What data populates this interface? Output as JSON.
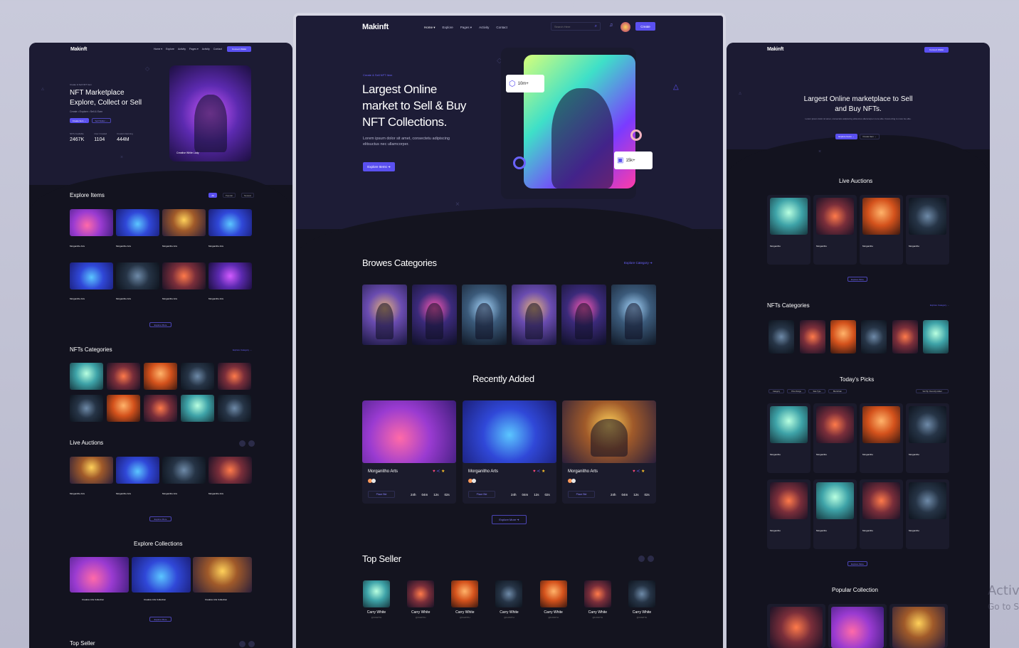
{
  "center": {
    "logo": "Makinft",
    "nav": [
      "Home ▾",
      "Explore",
      "Pages ▾",
      "Activity",
      "Contact"
    ],
    "search_placeholder": "Search Here",
    "create_label": "Create",
    "hero": {
      "eyebrow": "Create & Sell NFT Item",
      "title_lines": [
        "Largest Online",
        "market to Sell & Buy",
        "NFT Collections."
      ],
      "desc_lines": [
        "Lorem ipsum dolor sit amet, consectetu adipiscing",
        "elitsuctus nec ullamcorper."
      ],
      "cta": "Explore Items ➔",
      "badge1_value": "10m+",
      "badge2_value": "15k+"
    },
    "categories": {
      "title": "Browes Categories",
      "link": "Explore Category ➔"
    },
    "recent": {
      "title": "Recently Added",
      "cards": [
        {
          "name": "Morganitho Arts",
          "bid": "Place Bid",
          "timer": [
            "24h",
            "04m",
            "12s",
            "02s"
          ]
        },
        {
          "name": "Morganitho Arts",
          "bid": "Place Bid",
          "timer": [
            "24h",
            "04m",
            "12s",
            "02s"
          ]
        },
        {
          "name": "Morganitho Arts",
          "bid": "Place Bid",
          "timer": [
            "24h",
            "04m",
            "12s",
            "02s"
          ]
        }
      ],
      "more": "Explore More ➔"
    },
    "top_seller": {
      "title": "Top Seller",
      "sellers": [
        "Carry White",
        "Carry White",
        "Carry White",
        "Carry White",
        "Carry White",
        "Carry White",
        "Carry White"
      ],
      "handle": "@KAWITH"
    }
  },
  "left": {
    "logo": "Makinft",
    "nav": [
      "Home ▾",
      "Explore",
      "Activity",
      "Pages ▾",
      "Activity",
      "Contact"
    ],
    "connect": "Connect Wallet",
    "hero": {
      "eyebrow": "Create & Sell NFT Item",
      "title_lines": [
        "NFT Marketplace",
        "Explore, Collect or Sell"
      ],
      "sub": "Create • Explore • Sell & Earn",
      "btn1": "Create Item →",
      "btn2": "Sell Wallet →",
      "stats": [
        {
          "label": "NFTs Available",
          "value": "2467K"
        },
        {
          "label": "User Created",
          "value": "1104"
        },
        {
          "label": "Creators Earning",
          "value": "444M"
        }
      ],
      "card_title": "Creative White Lady"
    },
    "explore_title": "Explore Items",
    "filters": [
      "All",
      "Popular",
      "Newest"
    ],
    "item_name": "Morganitho Arts",
    "more": "Explore More",
    "nft_categories": "NFTs Categories",
    "categories_link": "Explore Category →",
    "live_auctions": "Live Auctions",
    "collections_title": "Explore Collections",
    "collection_name": "Creative Arts Collection",
    "top_seller": "Top Seller"
  },
  "right": {
    "logo": "Makinft",
    "connect": "Connect Wallet",
    "hero_lines": [
      "Largest Online marketplace to Sell",
      "and Buy NFTs."
    ],
    "hero_desc": "Lorem ipsum dolor sit amet, consectetu adipiscing elitsuctus ullamcorper more elite. Fusce ding to more be elite.",
    "btn1": "Explore Items →",
    "btn2": "Create Item →",
    "live_auctions": "Live Auctions",
    "item_name": "Morganitho",
    "nft_categories": "NFTs Categories",
    "categories_link": "Explore Category →",
    "todays_picks": "Today's Picks",
    "pick_filters": [
      "Category",
      "Price Range",
      "Sale Type",
      "Blockchain"
    ],
    "sort": "Sort By: Recently Added",
    "popular_collection": "Popular Collection",
    "more": "Explore More"
  },
  "watermark": [
    "Activ",
    "Go to S"
  ],
  "colors": {
    "accent": "#5a50f0",
    "bg": "#13131f",
    "hero": "#1c1b33"
  }
}
